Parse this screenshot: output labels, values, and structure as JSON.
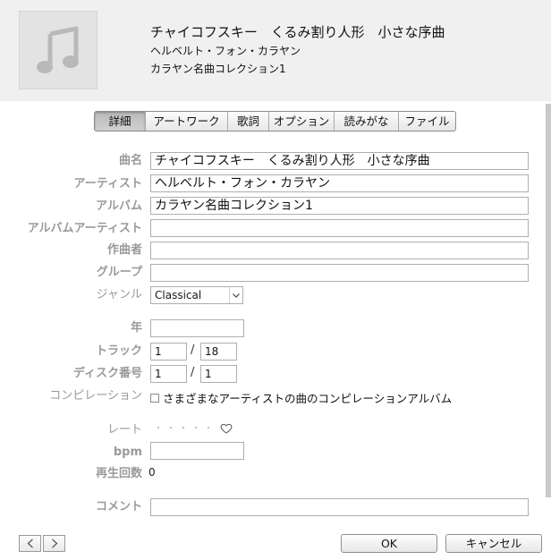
{
  "header": {
    "title": "チャイコフスキー　くるみ割り人形　小さな序曲",
    "artist": "ヘルベルト・フォン・カラヤン",
    "album": "カラヤン名曲コレクション1",
    "artwork_icon": "music-note-icon"
  },
  "tabs": [
    {
      "label": "詳細",
      "active": true
    },
    {
      "label": "アートワーク",
      "active": false
    },
    {
      "label": "歌詞",
      "active": false
    },
    {
      "label": "オプション",
      "active": false
    },
    {
      "label": "読みがな",
      "active": false
    },
    {
      "label": "ファイル",
      "active": false
    }
  ],
  "fields": {
    "song_name": {
      "label": "曲名",
      "value": "チャイコフスキー　くるみ割り人形　小さな序曲"
    },
    "artist": {
      "label": "アーティスト",
      "value": "ヘルベルト・フォン・カラヤン"
    },
    "album": {
      "label": "アルバム",
      "value": "カラヤン名曲コレクション1"
    },
    "album_artist": {
      "label": "アルバムアーティスト",
      "value": ""
    },
    "composer": {
      "label": "作曲者",
      "value": ""
    },
    "grouping": {
      "label": "グループ",
      "value": ""
    },
    "genre": {
      "label": "ジャンル",
      "value": "Classical"
    },
    "year": {
      "label": "年",
      "value": ""
    },
    "track": {
      "label": "トラック",
      "number": "1",
      "separator": "/",
      "total": "18"
    },
    "disc": {
      "label": "ディスク番号",
      "number": "1",
      "separator": "/",
      "total": "1"
    },
    "compilation": {
      "label": "コンピレーション",
      "checkbox_label": "さまざまなアーティストの曲のコンピレーションアルバム",
      "checked": false
    },
    "rating": {
      "label": "レート",
      "stars": 0,
      "max_stars": 5
    },
    "bpm": {
      "label": "bpm",
      "value": ""
    },
    "play_count": {
      "label": "再生回数",
      "value": "0"
    },
    "comment": {
      "label": "コメント",
      "value": ""
    }
  },
  "footer": {
    "ok_label": "OK",
    "cancel_label": "キャンセル"
  }
}
